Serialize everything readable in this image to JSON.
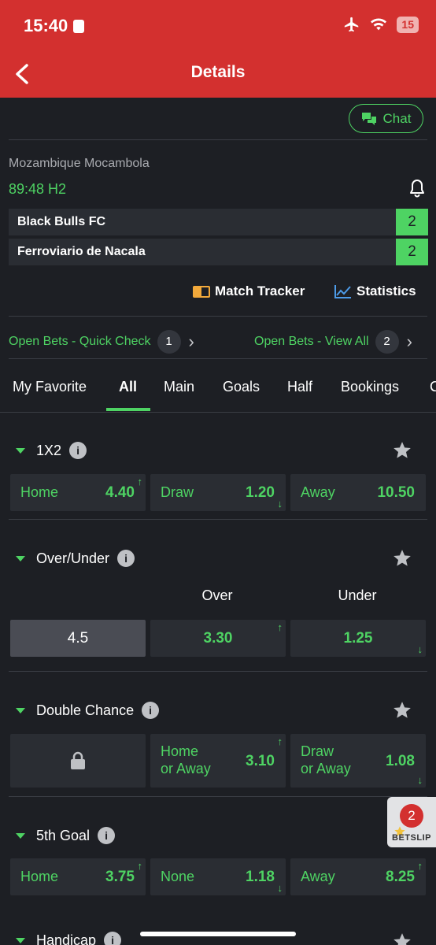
{
  "status_bar": {
    "time": "15:40",
    "battery": "15"
  },
  "header": {
    "title": "Details"
  },
  "chat": {
    "label": "Chat"
  },
  "match": {
    "league": "Mozambique Mocambola",
    "clock": "89:48 H2",
    "teams": [
      {
        "name": "Black Bulls FC",
        "score": "2"
      },
      {
        "name": "Ferroviario de Nacala",
        "score": "2"
      }
    ]
  },
  "links": {
    "tracker": "Match Tracker",
    "statistics": "Statistics"
  },
  "open_bets": {
    "quick_check": {
      "label": "Open Bets - Quick Check",
      "count": "1"
    },
    "view_all": {
      "label": "Open Bets - View All",
      "count": "2"
    }
  },
  "tabs": [
    "My Favorite",
    "All",
    "Main",
    "Goals",
    "Half",
    "Bookings",
    "C"
  ],
  "active_tab": "All",
  "markets": {
    "x12": {
      "title": "1X2",
      "odds": [
        {
          "label": "Home",
          "value": "4.40",
          "trend": "up"
        },
        {
          "label": "Draw",
          "value": "1.20",
          "trend": "down"
        },
        {
          "label": "Away",
          "value": "10.50",
          "trend": "none"
        }
      ]
    },
    "over_under": {
      "title": "Over/Under",
      "over_label": "Over",
      "under_label": "Under",
      "line": "4.5",
      "over_value": "3.30",
      "under_value": "1.25"
    },
    "double_chance": {
      "title": "Double Chance",
      "odds": [
        {
          "label_1": "Home",
          "label_2": "or Away",
          "value": "3.10",
          "trend": "up"
        },
        {
          "label_1": "Draw",
          "label_2": "or Away",
          "value": "1.08",
          "trend": "down"
        }
      ]
    },
    "fifth_goal": {
      "title": "5th Goal",
      "odds": [
        {
          "label": "Home",
          "value": "3.75",
          "trend": "up"
        },
        {
          "label": "None",
          "value": "1.18",
          "trend": "down"
        },
        {
          "label": "Away",
          "value": "8.25",
          "trend": "up"
        }
      ]
    },
    "handicap": {
      "title": "Handicap"
    }
  },
  "betslip": {
    "count": "2",
    "label": "BETSLIP"
  },
  "icons": {
    "back": "chevron-left-icon",
    "chat": "chat-bubbles-icon",
    "bell": "bell-icon",
    "star": "star-icon",
    "info": "info-icon",
    "lock": "lock-icon",
    "tracker": "match-tracker-icon",
    "stats": "line-chart-icon"
  },
  "colors": {
    "brand_red": "#d3302f",
    "accent_green": "#4ed363",
    "background": "#1d1f24",
    "cell": "#2a2d33"
  }
}
